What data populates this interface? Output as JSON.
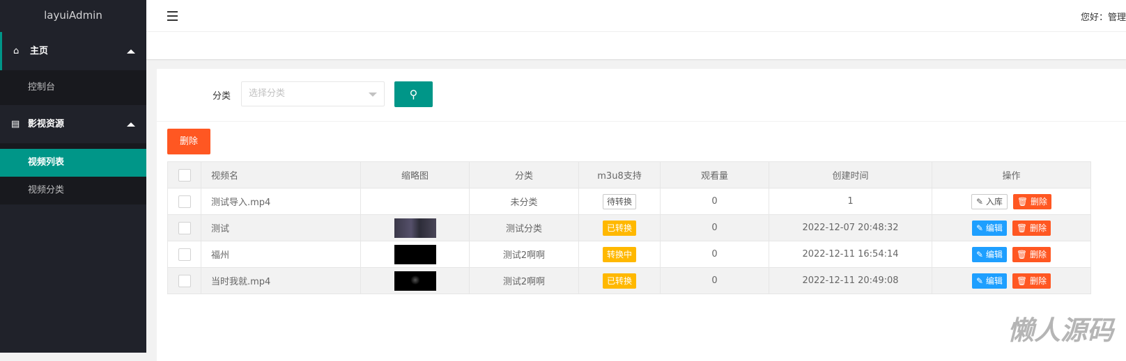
{
  "sidebar": {
    "logo": "layuiAdmin",
    "groups": [
      {
        "label": "主页",
        "items": [
          "控制台"
        ]
      },
      {
        "label": "影视资源",
        "items": [
          "视频列表",
          "视频分类"
        ]
      }
    ]
  },
  "header": {
    "greeting": "您好：管理"
  },
  "filter": {
    "label": "分类",
    "placeholder": "选择分类"
  },
  "toolbar": {
    "delete_label": "删除"
  },
  "table": {
    "headers": [
      "视频名",
      "缩略图",
      "分类",
      "m3u8支持",
      "观看量",
      "创建时间",
      "操作"
    ],
    "rows": [
      {
        "name": "测试导入.mp4",
        "category": "未分类",
        "m3u8": "待转换",
        "views": "0",
        "created": "1",
        "action1": "入库",
        "action2": "删除"
      },
      {
        "name": "测试",
        "category": "测试分类",
        "m3u8": "已转换",
        "views": "0",
        "created": "2022-12-07 20:48:32",
        "action1": "编辑",
        "action2": "删除"
      },
      {
        "name": "福州",
        "category": "测试2啊啊",
        "m3u8": "转换中",
        "views": "0",
        "created": "2022-12-11 16:54:14",
        "action1": "编辑",
        "action2": "删除"
      },
      {
        "name": "当时我就.mp4",
        "category": "测试2啊啊",
        "m3u8": "已转换",
        "views": "0",
        "created": "2022-12-11 20:49:08",
        "action1": "编辑",
        "action2": "删除"
      }
    ]
  },
  "watermark": "懒人源码"
}
